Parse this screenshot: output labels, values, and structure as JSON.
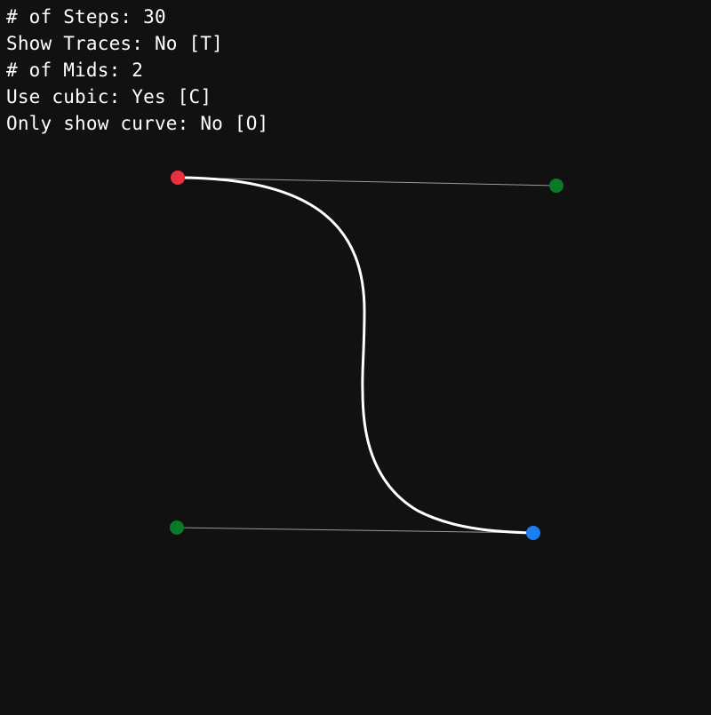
{
  "hud": {
    "steps": "# of Steps: 30",
    "traces": "Show Traces: No [T]",
    "mids": "# of Mids: 2",
    "cubic": "Use cubic: Yes [C]",
    "only_curve": "Only show curve: No [O]"
  },
  "colors": {
    "background": "#111111",
    "curve": "#ffffff",
    "control_line": "#9a9a9a",
    "start_point": "#e8303f",
    "end_point": "#1a7ff0",
    "control_point": "#0a7a2a"
  }
}
